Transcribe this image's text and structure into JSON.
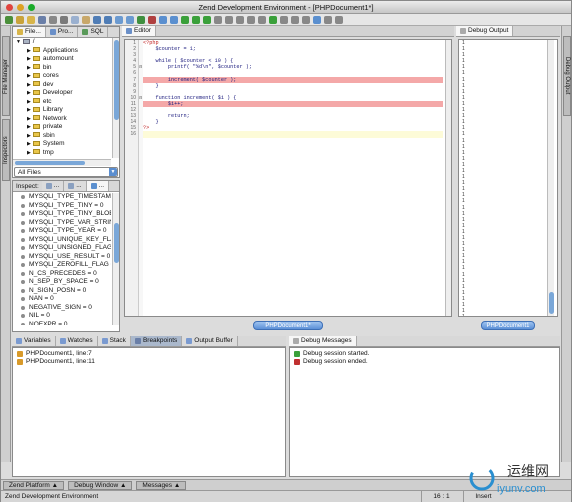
{
  "window": {
    "title": "Zend Development Environment - [PHPDocument1*]"
  },
  "left_rail": {
    "file_manager": "File Manager",
    "inspectors": "Inspectors"
  },
  "right_rail": {
    "debug_output": "Debug Output"
  },
  "file_panel": {
    "tabs": [
      "File...",
      "Pro...",
      "SQL"
    ],
    "root": "/",
    "items": [
      "Applications",
      "automount",
      "bin",
      "cores",
      "dev",
      "Developer",
      "etc",
      "Library",
      "Network",
      "private",
      "sbin",
      "System",
      "tmp"
    ],
    "filter": "All Files"
  },
  "inspect_panel": {
    "label": "Inspect:",
    "items": [
      "MYSQLI_TYPE_TIMESTAMP",
      "MYSQLI_TYPE_TINY = 0",
      "MYSQLI_TYPE_TINY_BLOB",
      "MYSQLI_TYPE_VAR_STRING",
      "MYSQLI_TYPE_YEAR = 0",
      "MYSQLI_UNIQUE_KEY_FLAG",
      "MYSQLI_UNSIGNED_FLAG",
      "MYSQLI_USE_RESULT = 0",
      "MYSQLI_ZEROFILL_FLAG =",
      "N_CS_PRECEDES = 0",
      "N_SEP_BY_SPACE = 0",
      "N_SIGN_POSN = 0",
      "NAN = 0",
      "NEGATIVE_SIGN = 0",
      "NIL = 0",
      "NOEXPR = 0"
    ]
  },
  "editor": {
    "tab": "Editor",
    "line_numbers": [
      "1",
      "2",
      "3",
      "4",
      "5",
      "6",
      "7",
      "8",
      "9",
      "10",
      "11",
      "12",
      "13",
      "14",
      "15",
      "16"
    ],
    "lines": [
      "<?php",
      "    $counter = 1;",
      "",
      "    while ( $counter < 10 ) {",
      "        printf( \"%d\\n\", $counter );",
      "",
      "        increment( $counter );",
      "    }",
      "",
      "    function increment( $i ) {",
      "        $i++;",
      "",
      "        return;",
      "    }",
      "?>",
      ""
    ],
    "document_tab": "PHPDocument1*"
  },
  "debug_output": {
    "tab": "Debug Output",
    "numbers": [
      "1",
      "1",
      "1",
      "1",
      "1",
      "1",
      "1",
      "1",
      "1",
      "1",
      "1",
      "1",
      "1",
      "1",
      "1",
      "1",
      "1",
      "1",
      "1",
      "1",
      "1",
      "1",
      "1",
      "1",
      "1",
      "1",
      "1",
      "1",
      "1",
      "1",
      "1",
      "1",
      "1",
      "1",
      "1",
      "1",
      "1",
      "1",
      "1",
      "1",
      "1",
      "1",
      "1",
      "1",
      "1",
      "1",
      "1"
    ],
    "document_tab": "PHPDocument1"
  },
  "debug_tabs": [
    "Variables",
    "Watches",
    "Stack",
    "Breakpoints",
    "Output Buffer"
  ],
  "breakpoints": [
    "PHPDocument1, line:7",
    "PHPDocument1, line:11"
  ],
  "debug_messages": {
    "tab": "Debug Messages",
    "items": [
      "Debug session started.",
      "Debug session ended."
    ]
  },
  "taskbar": [
    "Zend Platform",
    "Debug Window",
    "Messages"
  ],
  "status": {
    "app": "Zend Development Environment",
    "position": "16 : 1",
    "mode": "Insert"
  },
  "watermark": {
    "cn": "运维网",
    "site": "iyunv.com"
  }
}
